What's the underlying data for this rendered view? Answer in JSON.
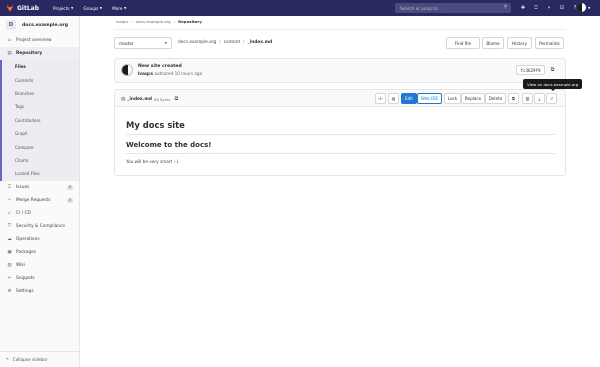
{
  "navbar": {
    "brand": "GitLab",
    "menu": [
      {
        "label": "Projects"
      },
      {
        "label": "Groups"
      },
      {
        "label": "More"
      }
    ],
    "search_placeholder": "Search or jump to...",
    "icons": [
      "plus-icon",
      "issues-icon",
      "merge-request-icon",
      "todo-icon",
      "help-icon"
    ],
    "colors": {
      "background": "#292961"
    }
  },
  "sidebar": {
    "project_initial": "D",
    "project_name": "docs.example.org",
    "items": [
      {
        "label": "Project overview",
        "icon": "home-icon"
      },
      {
        "label": "Repository",
        "icon": "doc-icon"
      }
    ],
    "repository_subitems": [
      {
        "label": "Files"
      },
      {
        "label": "Commits"
      },
      {
        "label": "Branches"
      },
      {
        "label": "Tags"
      },
      {
        "label": "Contributors"
      },
      {
        "label": "Graph"
      },
      {
        "label": "Compare"
      },
      {
        "label": "Charts"
      },
      {
        "label": "Locked Files"
      }
    ],
    "lower_items": [
      {
        "label": "Issues",
        "icon": "issues-icon",
        "count": "0"
      },
      {
        "label": "Merge Requests",
        "icon": "merge-request-icon",
        "count": "0"
      },
      {
        "label": "CI / CD",
        "icon": "rocket-icon"
      },
      {
        "label": "Security & Compliance",
        "icon": "shield-icon"
      },
      {
        "label": "Operations",
        "icon": "cloud-icon"
      },
      {
        "label": "Packages",
        "icon": "package-icon"
      },
      {
        "label": "Wiki",
        "icon": "book-icon"
      },
      {
        "label": "Snippets",
        "icon": "scissors-icon"
      },
      {
        "label": "Settings",
        "icon": "gear-icon"
      }
    ],
    "collapse_label": "Collapse sidebar"
  },
  "breadcrumb": {
    "items": [
      "lvaqcs",
      "docs.example.org"
    ],
    "current": "Repository"
  },
  "repo": {
    "branch": "master",
    "path": [
      "docs.example.org",
      "content"
    ],
    "current_file": "_index.md",
    "buttons": {
      "find_file": "Find file",
      "blame": "Blame",
      "history": "History",
      "permalink": "Permalink"
    }
  },
  "commit": {
    "title": "New site created",
    "author": "lvaqcs",
    "meta": "authored 10 hours ago",
    "sha": "fc3629f9"
  },
  "file": {
    "name": "_index.md",
    "size": "68 Bytes",
    "buttons": {
      "edit": "Edit",
      "web_ide": "Web IDE",
      "lock": "Lock",
      "replace": "Replace",
      "delete": "Delete"
    },
    "tooltip": "View on docs.example.org"
  },
  "document": {
    "h1": "My docs site",
    "h2": "Welcome to the docs!",
    "p": "You will be very smart :-)."
  }
}
